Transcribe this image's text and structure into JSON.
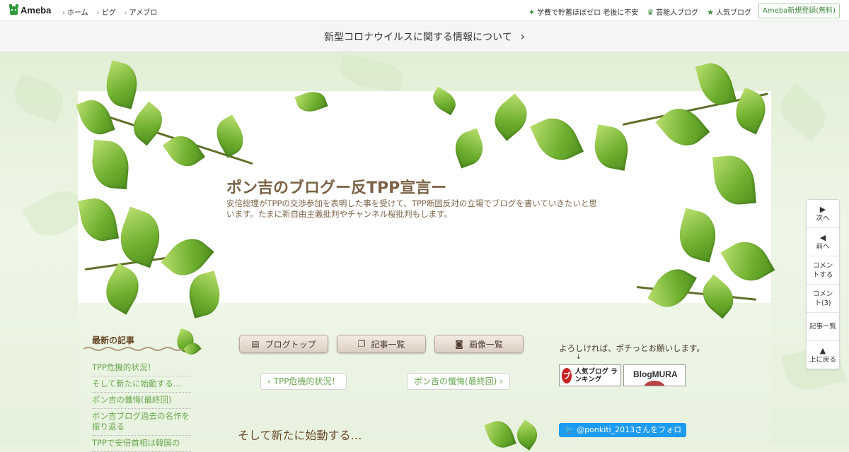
{
  "topbar": {
    "logo_text": "Ameba",
    "nav_left": [
      "ホーム",
      "ピグ",
      "アメブロ"
    ],
    "nav_right": [
      {
        "icon": "sparkle-icon",
        "label": "学費で貯蓄ほぼゼロ 老後に不安"
      },
      {
        "icon": "crown-icon",
        "label": "芸能人ブログ"
      },
      {
        "icon": "star-icon",
        "label": "人気ブログ"
      }
    ],
    "signup_label": "Ameba新規登録(無料)"
  },
  "notice": {
    "text": "新型コロナウイルスに関する情報について"
  },
  "blog": {
    "title": "ポン吉のブログー反TPP宣言ー",
    "description": "安倍総理がTPPの交渉参加を表明した事を受けて、TPP断固反対の立場でブログを書いていきたいと思います。たまに新自由主義批判やチャンネル桜批判もします。"
  },
  "sidebar": {
    "recent_heading": "最新の記事",
    "recent_items": [
      "TPP危機的状況！",
      "そして新たに始動する…",
      "ポン吉の懺悔(最終回)",
      "ポン吉ブログ過去の名作を振り返る",
      "TPPで安倍首相は韓国の"
    ]
  },
  "tabs": {
    "top": "ブログトップ",
    "list": "記事一覧",
    "images": "画像一覧"
  },
  "pager": {
    "prev": "TPP危機的状況！",
    "next": "ポン吉の懺悔(最終回)"
  },
  "entry": {
    "title": "そして新たに始動する…"
  },
  "right_sidebar": {
    "message": "よろしければ、ポチっとお願いします。",
    "arrow": "↓",
    "banner_rank_text": "人気ブログ ランキング",
    "banner_mura_text": "BlogMURA",
    "follow_label": "@ponkiti_2013さんをフォロー"
  },
  "side_nav": [
    {
      "icon": "play-right-icon",
      "label": "次へ"
    },
    {
      "icon": "play-left-icon",
      "label": "前へ"
    },
    {
      "icon": "",
      "label": "コメントする"
    },
    {
      "icon": "",
      "label": "コメント(3)"
    },
    {
      "icon": "",
      "label": "記事一覧"
    },
    {
      "icon": "triangle-up-icon",
      "label": "上に戻る"
    }
  ],
  "colors": {
    "accent_green": "#6aa84f",
    "title_brown": "#7b6246",
    "twitter_blue": "#1d9bf0"
  }
}
